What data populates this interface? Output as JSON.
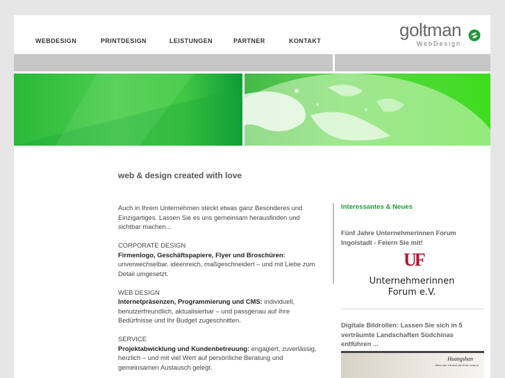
{
  "nav": {
    "items": [
      {
        "label": "WEBDESIGN"
      },
      {
        "label": "PRINTDESIGN"
      },
      {
        "label": "LEISTUNGEN"
      },
      {
        "label": "PARTNER"
      },
      {
        "label": "KONTAKT"
      }
    ]
  },
  "logo": {
    "word": "goltman",
    "sub": "WebDesign",
    "icon": "goltman-logo-icon",
    "colors": {
      "accent": "#1f9a3a",
      "text": "#666666"
    }
  },
  "tagline": "web & design created with love",
  "intro": "Auch in Ihrem Unternehmen steckt etwas ganz Besonderes und Einzigartiges. Lassen Sie es uns gemeinsam herausfinden und sichtbar machen...",
  "sections": [
    {
      "heading": "CORPORATE DESIGN",
      "bold": "Firmenlogo, Geschäftspapiere, Flyer und Broschüren:",
      "text": " unverwechselbar, ideenreich, maßgeschneidert – und mit Liebe zum Detail umgesetzt."
    },
    {
      "heading": "WEB DESIGN",
      "bold": "Internetpräsenzen, Programmierung und CMS:",
      "text": " individuell, benutzerfreundlich, aktualisierbar – und passgenau auf Ihre Bedürfnisse und Ihr Budget zugeschnitten."
    },
    {
      "heading": "SERVICE",
      "bold": "Projektabwicklung und Kundenbetreuung:",
      "text": " engagiert, zuverlässig, herzlich – und mit viel Wert auf persönliche Beratung und gemeinsamen Austausch gelegt."
    }
  ],
  "aside": {
    "title": "Interessantes & Neues",
    "news1": "Fünf Jahre Unternehmerinnen Forum Ingolstadt - Feiern Sie mit!",
    "uf_logo": {
      "mark": "UF",
      "line1": "Unternehmerinnen",
      "line2": "Forum e.V.",
      "color": "#b2122e"
    },
    "news2": "Digitale Bildrollen: Lassen Sie sich in 5 verträumte Landschaften Südchinas entführen ...",
    "thumb_label": "Huangshan",
    "thumb_sub": "Wenn der Himmel die Erde umarmt"
  },
  "colors": {
    "page_bg": "#e6e6e6",
    "bar_grey": "#c7c7c7",
    "green": "#3fc743",
    "green_dark": "#0d9a35"
  }
}
